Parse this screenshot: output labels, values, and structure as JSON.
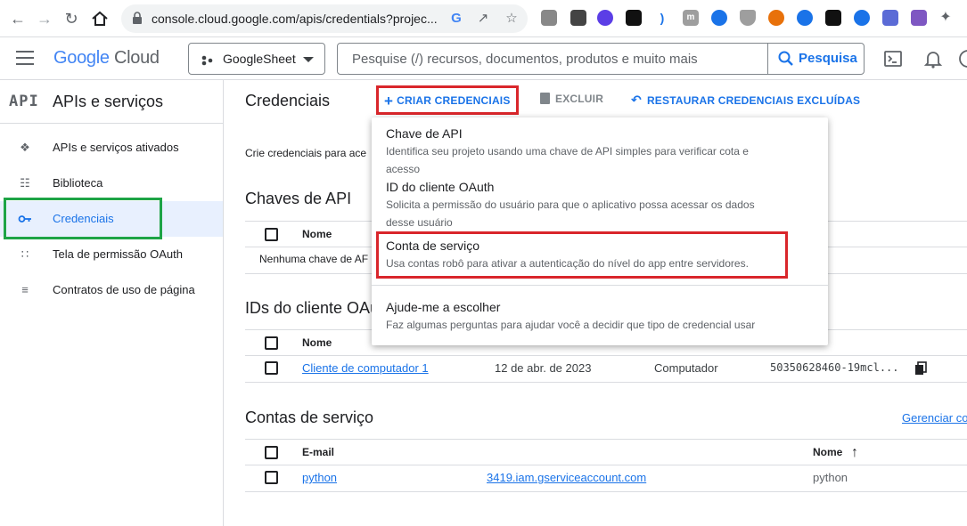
{
  "browser": {
    "url": "console.cloud.google.com/apis/credentials?projec..."
  },
  "header": {
    "logo_google": "Google",
    "logo_cloud": "Cloud",
    "project_name": "GoogleSheet",
    "search_placeholder": "Pesquise (/) recursos, documentos, produtos e muito mais",
    "search_button": "Pesquisa"
  },
  "sidebar": {
    "badge": "API",
    "title": "APIs e serviços",
    "items": [
      {
        "label": "APIs e serviços ativados",
        "icon": "diamond-grid-icon"
      },
      {
        "label": "Biblioteca",
        "icon": "library-icon"
      },
      {
        "label": "Credenciais",
        "icon": "key-icon"
      },
      {
        "label": "Tela de permissão OAuth",
        "icon": "dots-grid-icon"
      },
      {
        "label": "Contratos de uso de página",
        "icon": "settings-list-icon"
      }
    ]
  },
  "toolbar": {
    "title": "Credenciais",
    "create_label": "CRIAR CREDENCIAIS",
    "delete_label": "EXCLUIR",
    "restore_label": "RESTAURAR CREDENCIAIS EXCLUÍDAS"
  },
  "main": {
    "description": "Crie credenciais para ace",
    "api_keys": {
      "title": "Chaves de API",
      "col_name": "Nome",
      "empty": "Nenhuma chave de AF"
    },
    "oauth": {
      "title": "IDs do cliente OAu",
      "col_name": "Nome",
      "rows": [
        {
          "name": "Cliente de computador 1",
          "date": "12 de abr. de 2023",
          "type": "Computador",
          "client_id": "50350628460-19mcl..."
        }
      ]
    },
    "service_accounts": {
      "title": "Contas de serviço",
      "manage_link": "Gerenciar co",
      "col_email": "E-mail",
      "col_name": "Nome",
      "rows": [
        {
          "email": "python",
          "account": "3419.iam.gserviceaccount.com",
          "name": "python"
        }
      ]
    }
  },
  "dropdown": {
    "items": [
      {
        "title": "Chave de API",
        "desc": "Identifica seu projeto usando uma chave de API simples para verificar cota e",
        "desc2": "acesso"
      },
      {
        "title": "ID do cliente OAuth",
        "desc": "Solicita a permissão do usuário para que o aplicativo possa acessar os dados",
        "desc2": "desse usuário"
      },
      {
        "title": "Conta de serviço",
        "desc": "Usa contas robô para ativar a autenticação do nível do app entre servidores."
      },
      {
        "title": "Ajude-me a escolher",
        "desc": "Faz algumas perguntas para ajudar você a decidir que tipo de credencial usar"
      }
    ]
  },
  "colors": {
    "accent": "#1a73e8",
    "highlight_red": "#d9262b",
    "highlight_green": "#1ea446"
  }
}
